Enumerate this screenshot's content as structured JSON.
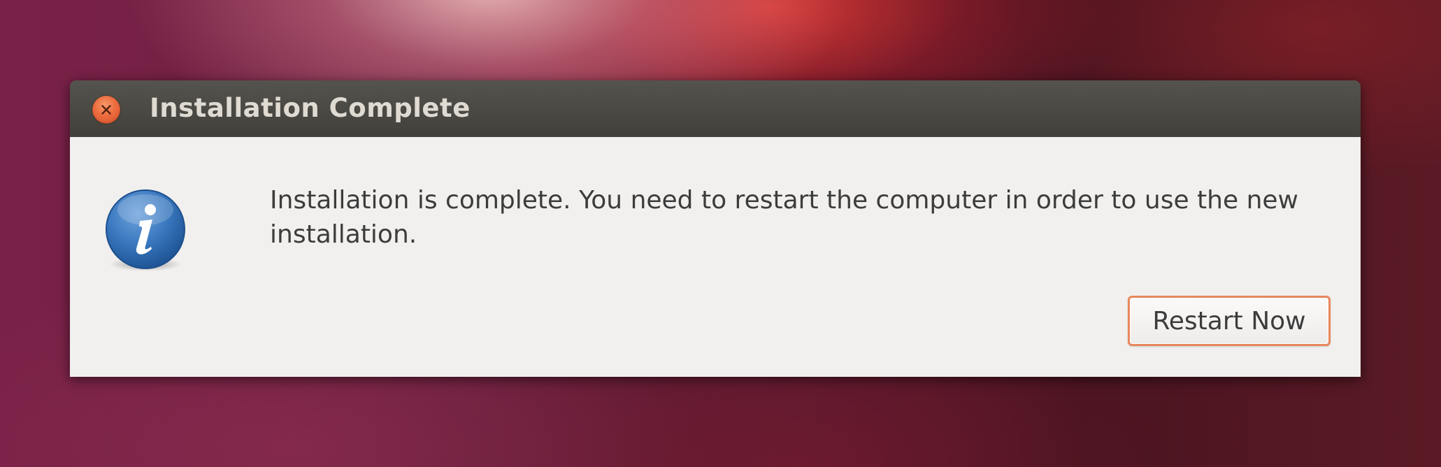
{
  "dialog": {
    "title": "Installation Complete",
    "close_icon": "close-icon",
    "info_icon": "info-icon",
    "message": "Installation is complete. You need to restart the computer in order to use the new installation.",
    "primary_button_label": "Restart Now"
  },
  "colors": {
    "titlebar": "#42403b",
    "title_text": "#dfdbd2",
    "close_button": "#ec6b3e",
    "body_background": "#f1f0ee",
    "info_icon_blue": "#2f6db3",
    "button_focus_border": "#e8875c",
    "text": "#3c3c3c"
  }
}
